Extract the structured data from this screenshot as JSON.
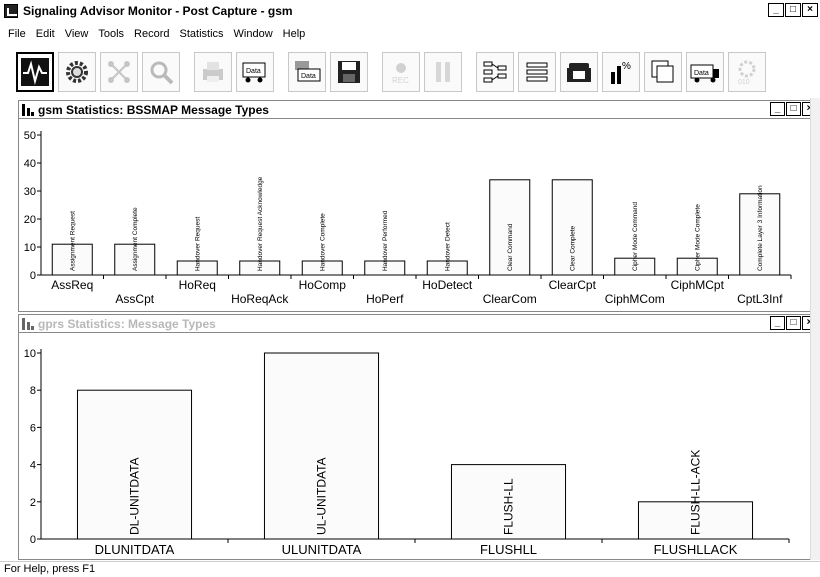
{
  "window": {
    "title": "Signaling Advisor Monitor - Post Capture - gsm",
    "min_label": "_",
    "max_label": "□",
    "close_label": "×"
  },
  "menu": {
    "items": [
      "File",
      "Edit",
      "View",
      "Tools",
      "Record",
      "Statistics",
      "Window",
      "Help"
    ]
  },
  "toolbar": {
    "buttons": [
      {
        "icon": "waveform-icon"
      },
      {
        "icon": "gear-icon"
      },
      {
        "icon": "network-icon"
      },
      {
        "icon": "magnifier-icon"
      },
      {
        "icon": "printer-icon"
      },
      {
        "icon": "data-export-icon",
        "label": "Data"
      },
      {
        "icon": "data-import-icon",
        "label": "Data"
      },
      {
        "icon": "save-icon"
      },
      {
        "icon": "record-icon",
        "label": "REC"
      },
      {
        "icon": "pause-icon"
      },
      {
        "icon": "topology-icon"
      },
      {
        "icon": "list-icon"
      },
      {
        "icon": "telephone-icon"
      },
      {
        "icon": "percent-chart-icon",
        "label": "%"
      },
      {
        "icon": "windows-icon"
      },
      {
        "icon": "data-truck-icon",
        "label": "Data"
      },
      {
        "icon": "binary-gear-icon",
        "label": "010"
      }
    ]
  },
  "gsm_window": {
    "title": "gsm Statistics: BSSMAP Message Types"
  },
  "gprs_window": {
    "title": "gprs Statistics: Message Types"
  },
  "status": {
    "text": "For Help, press F1"
  },
  "chart_data": [
    {
      "type": "bar",
      "title": "",
      "ylim": [
        0,
        50
      ],
      "yticks": [
        0,
        10,
        20,
        30,
        40,
        50
      ],
      "categories": [
        "AssReq",
        "AssCpt",
        "HoReq",
        "HoReqAck",
        "HoComp",
        "HoPerf",
        "HoDetect",
        "ClearCom",
        "ClearCpt",
        "CiphMCom",
        "CiphMCpt",
        "CptL3Inf"
      ],
      "bar_labels": [
        "Assignment Request",
        "Assignment Complete",
        "Handover Request",
        "Handover Request Acknowledge",
        "Handover Complete",
        "Handover Performed",
        "Handover Detect",
        "Clear Command",
        "Clear Complete",
        "Cipher Mode Command",
        "Cipher Mode Complete",
        "Complete Layer 3 Information"
      ],
      "values": [
        11,
        11,
        5,
        5,
        5,
        5,
        5,
        34,
        34,
        6,
        6,
        29
      ]
    },
    {
      "type": "bar",
      "title": "",
      "ylim": [
        0,
        10
      ],
      "yticks": [
        0,
        2,
        4,
        6,
        8,
        10
      ],
      "categories": [
        "DLUNITDATA",
        "ULUNITDATA",
        "FLUSHLL",
        "FLUSHLLACK"
      ],
      "bar_labels": [
        "DL-UNITDATA",
        "UL-UNITDATA",
        "FLUSH-LL",
        "FLUSH-LL-ACK"
      ],
      "values": [
        8,
        10,
        4,
        2
      ]
    }
  ]
}
